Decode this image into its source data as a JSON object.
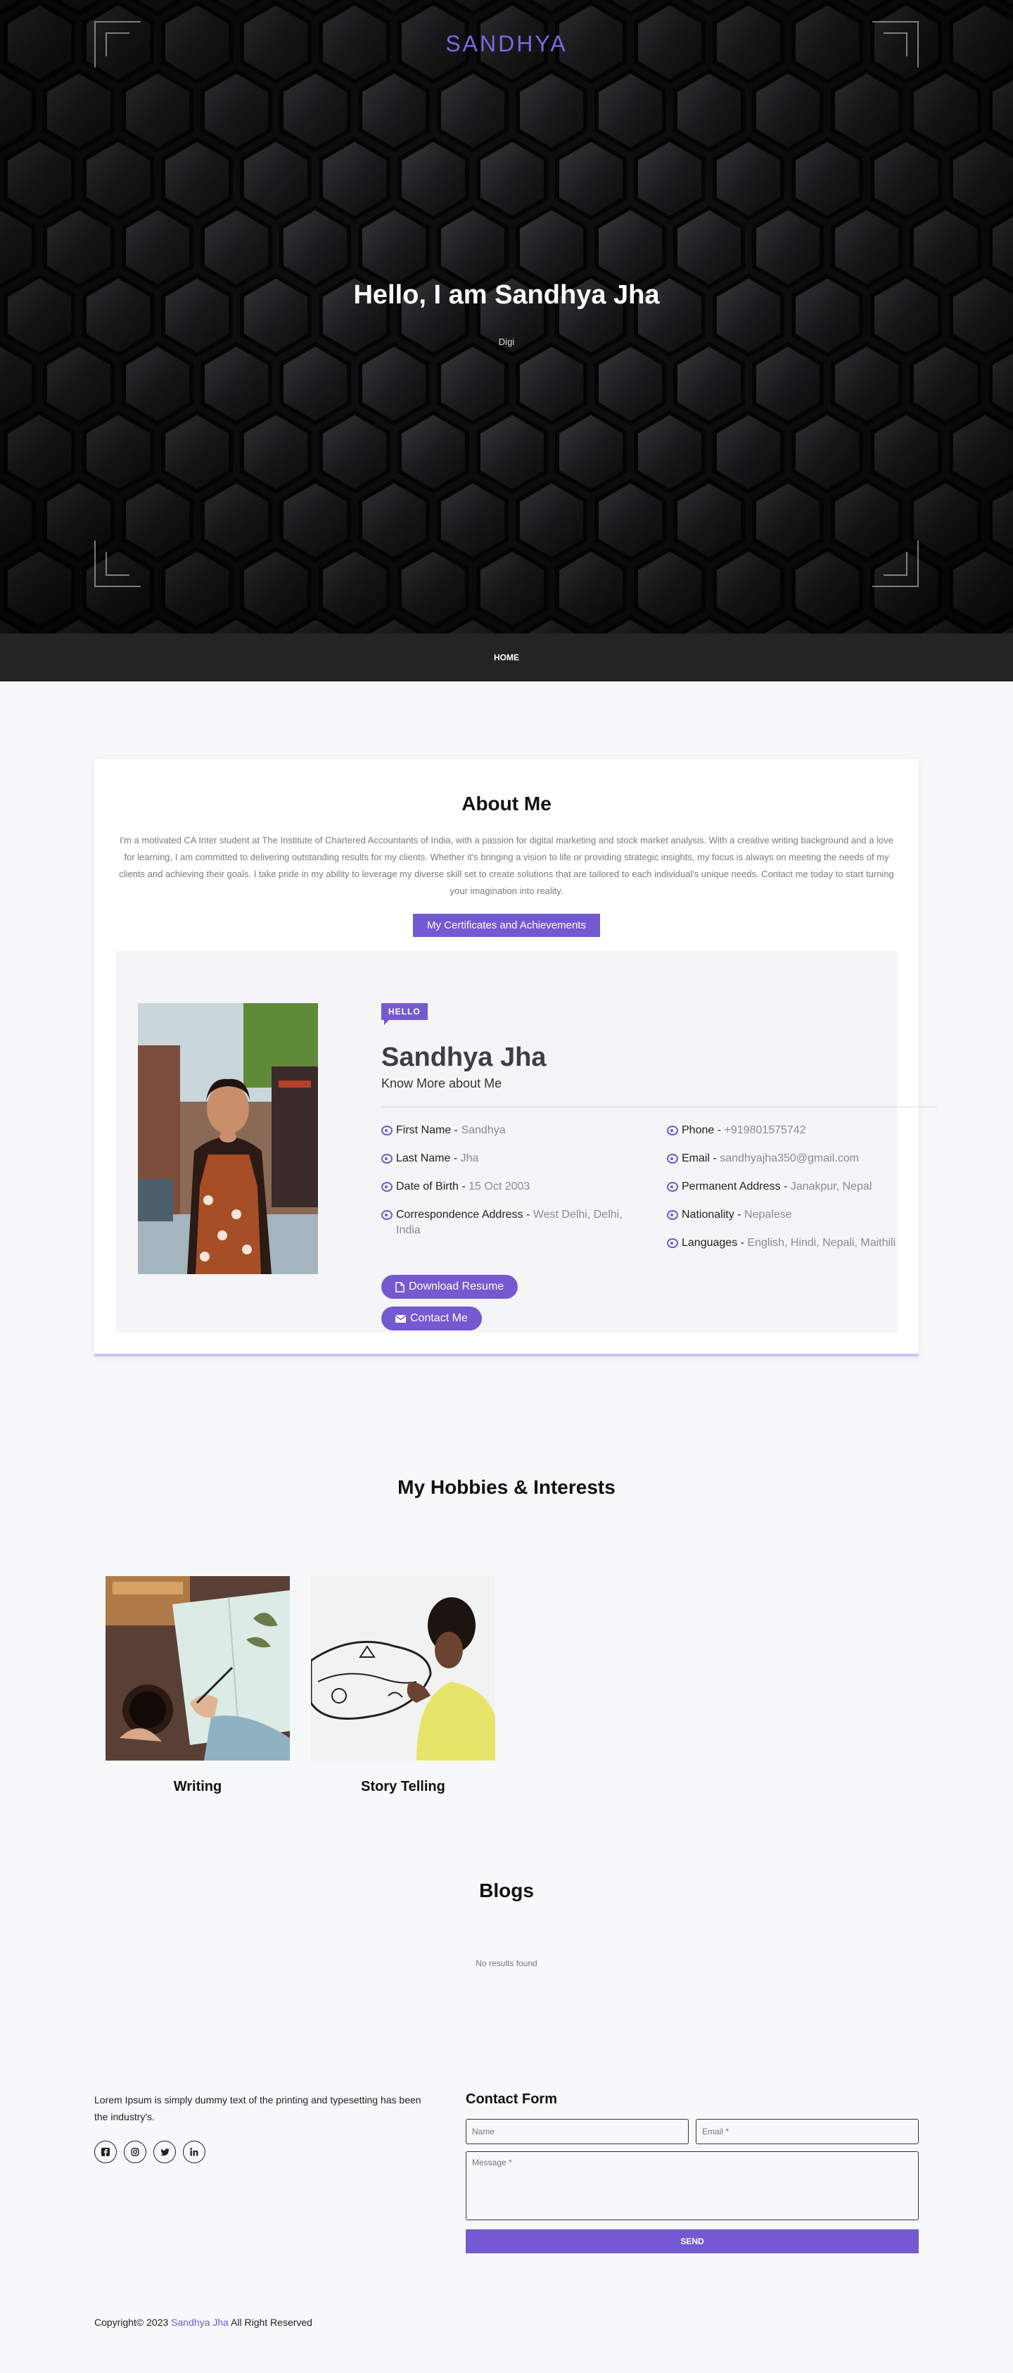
{
  "hero": {
    "brand": "SANDHYA",
    "title": "Hello, I am Sandhya Jha",
    "subtitle": "Digi"
  },
  "nav": {
    "home": "HOME"
  },
  "about": {
    "title": "About Me",
    "text": "I'm a motivated CA Inter student at The Institute of Chartered Accountants of India, with a passion for digital marketing and stock market analysis. With a creative writing background and a love for learning, I am committed to delivering outstanding results for my clients. Whether it's bringing a vision to life or providing strategic insights, my focus is always on meeting the needs of my clients and achieving their goals. I take pride in my ability to leverage my diverse skill set to create solutions that are tailored to each individual's unique needs. Contact me today to start turning your imagination into reality.",
    "cert_button": "My Certificates and Achievements",
    "hello": "HELLO",
    "name": "Sandhya Jha",
    "tagline": "Know More about Me",
    "left_info": [
      {
        "label": "First Name",
        "value": "Sandhya"
      },
      {
        "label": "Last Name",
        "value": "Jha"
      },
      {
        "label": "Date of Birth",
        "value": "15 Oct 2003"
      },
      {
        "label": "Correspondence Address",
        "value": "West Delhi, Delhi, India"
      }
    ],
    "right_info": [
      {
        "label": "Phone",
        "value": "+919801575742"
      },
      {
        "label": "Email",
        "value": "sandhyajha350@gmail.com"
      },
      {
        "label": "Permanent Address",
        "value": "Janakpur, Nepal"
      },
      {
        "label": "Nationality",
        "value": "Nepalese"
      },
      {
        "label": "Languages",
        "value": "English, Hindi, Nepali, Maithili"
      }
    ],
    "download_resume": "Download Resume",
    "contact_me": "Contact Me"
  },
  "hobbies": {
    "title": "My Hobbies & Interests",
    "items": [
      {
        "label": "Writing"
      },
      {
        "label": "Story Telling"
      }
    ]
  },
  "blogs": {
    "title": "Blogs",
    "empty": "No results found"
  },
  "footer": {
    "text": "Lorem Ipsum is simply dummy text of the printing and typesetting has been the industry's.",
    "socials": [
      "facebook-icon",
      "instagram-icon",
      "twitter-icon",
      "linkedin-icon"
    ],
    "contact_title": "Contact Form",
    "name_placeholder": "Name",
    "email_placeholder": "Email *",
    "message_placeholder": "Message *",
    "send": "SEND",
    "copyright_prefix": "Copyright© 2023",
    "copyright_name": "Sandhya Jha",
    "copyright_suffix": "All Right Reserved"
  },
  "colors": {
    "accent": "#7459d1",
    "brand": "#7c68e0",
    "nav_bg": "#242424"
  }
}
